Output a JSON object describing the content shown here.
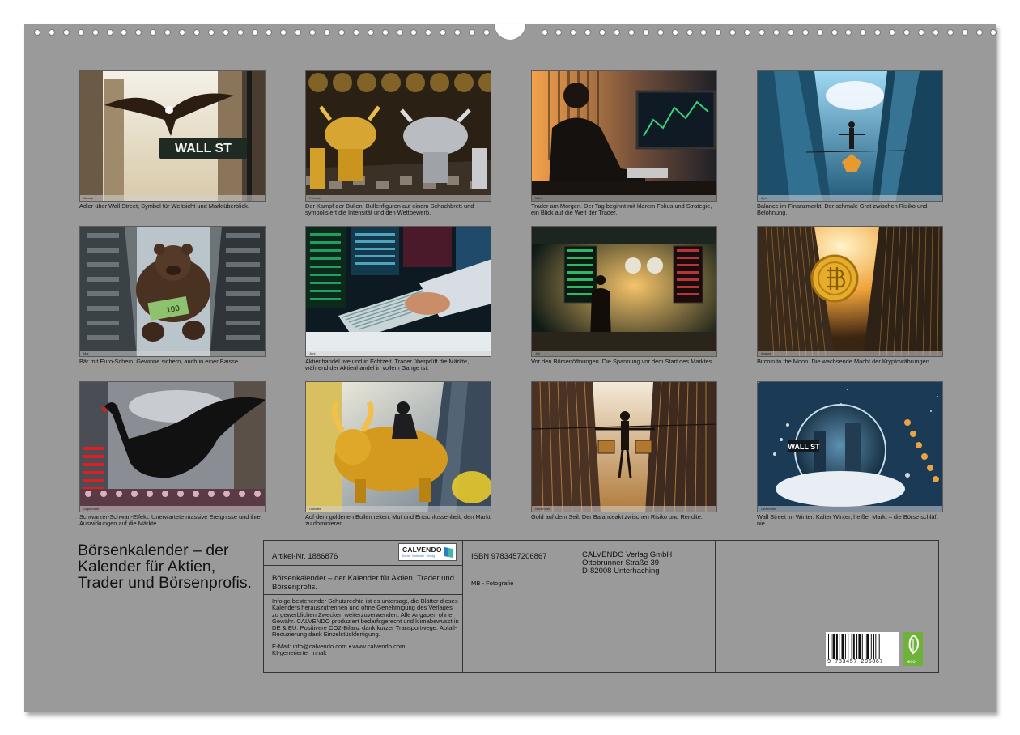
{
  "title": "Börsenkalender – der Kalender für Aktien, Trader und Börsenprofis.",
  "months": [
    {
      "month": "Januar",
      "caption": "Adler über Wall Street, Symbol für Weitsicht und Marktüberblick.",
      "scene": "eagle-wallst"
    },
    {
      "month": "Februar",
      "caption": "Der Kampf der Bullen. Bullenfiguren auf einem Schachbrett und symbolisiert die Intensität und den Wettbewerb.",
      "scene": "chess-bulls"
    },
    {
      "month": "März",
      "caption": "Trader am Morgen. Der Tag beginnt mit klarem Fokus und Strategie, ein Blick auf die Welt der Trader.",
      "scene": "trader-desk"
    },
    {
      "month": "April",
      "caption": "Balance im Finanzmarkt. Der schmale Grat zwischen Risiko und Belohnung.",
      "scene": "tightrope-sky"
    },
    {
      "month": "Mai",
      "caption": "Bär mit Euro-Schein. Gewinne sichern, auch in einer Baisse.",
      "scene": "bear-euro"
    },
    {
      "month": "Juni",
      "caption": "Aktienhandel live und in Echtzeit. Trader überprüft die Märkte, während der Aktienhandel in vollem Gange ist.",
      "scene": "banknotes-screens"
    },
    {
      "month": "Juli",
      "caption": "Vor den Börsenöffnungen. Die Spannung vor dem Start des Marktes.",
      "scene": "exchange-hall"
    },
    {
      "month": "August",
      "caption": "Bitcoin to the Moon. Die wachsende Macht der Kryptowährungen.",
      "scene": "bitcoin-city"
    },
    {
      "month": "September",
      "caption": "Schwarzer-Schwan-Effekt. Unerwartete massive Ereignisse und ihre Auswirkungen auf die Märkte.",
      "scene": "black-swan"
    },
    {
      "month": "Oktober",
      "caption": "Auf dem goldenen Bullen reiten. Mut und Entschlossenheit, den Markt zu dominieren.",
      "scene": "golden-bull-rider"
    },
    {
      "month": "November",
      "caption": "Gold auf dem Seil. Der Balanceakt zwischen Risiko und Rendite.",
      "scene": "gold-rope"
    },
    {
      "month": "Dezember",
      "caption": "Wall Street im Winter. Kalter Winter, heißer Markt – die Börse schläft nie.",
      "scene": "snow-globe"
    }
  ],
  "info": {
    "article": "Artikel-Nr. 1886876",
    "logo_name": "CALVENDO",
    "logo_tag": "Kunst · Kalender · Verlag",
    "product_title": "Börsenkalender – der Kalender für Aktien, Trader und Börsenprofis.",
    "legal": "Infolge bestehender Schutzrechte ist es untersagt, die Blätter dieses Kalenders herauszutrennen und ohne Genehmigung des Verlages zu gewerblichen Zwecken weiterzuverwenden. Alle Angaben ohne Gewähr. CALVENDO produziert bedarfsgerecht und klimabewusst in DE & EU. Positivere CO2-Bilanz dank kurzer Transportwege. Abfall-Reduzierung dank Einzelstückfertigung.",
    "contact": "E-Mail: info@calvendo.com • www.calvendo.com",
    "ai_note": "KI-generierter Inhalt",
    "isbn": "ISBN 9783457206867",
    "author": "MB - Fotografie",
    "publisher_name": "CALVENDO Verlag GmbH",
    "publisher_street": "Ottobrunner Straße 39",
    "publisher_city": "D-82008 Unterhaching",
    "barcode_digits": "9 783457 206867",
    "eco_label": "eco"
  },
  "image_text": {
    "wall_st_sign": "WALL ST",
    "globe_sign": "WALL ST",
    "euro_note": "100"
  },
  "colors": {
    "sheet": "#9a9a9a",
    "text": "#111111",
    "gold": "#d9a520",
    "eco_green": "#6fb23a",
    "calvendo_blue": "#3a86c8"
  }
}
